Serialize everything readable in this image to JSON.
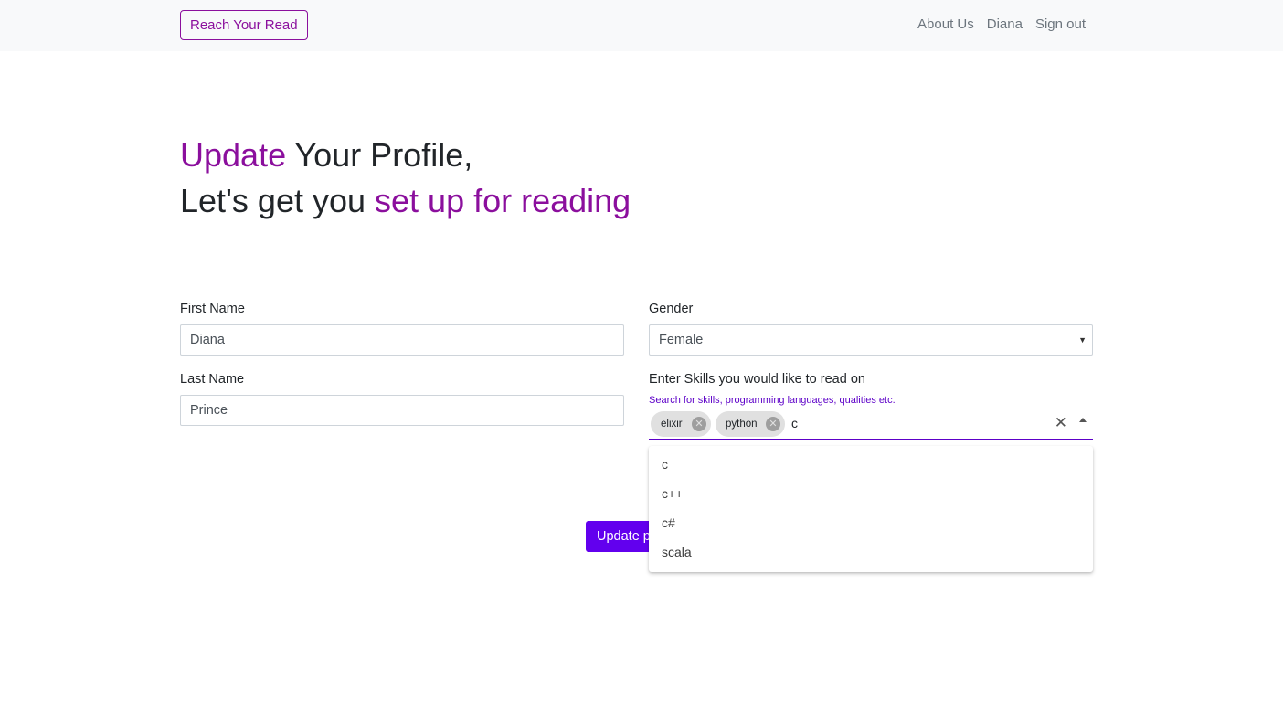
{
  "nav": {
    "brand": "Reach Your Read",
    "links": [
      "About Us",
      "Diana",
      "Sign out"
    ]
  },
  "heading": {
    "line1_accent": "Update",
    "line1_rest": " Your Profile,",
    "line2_plain": "Let's get you ",
    "line2_accent": "set up for reading"
  },
  "form": {
    "first_name_label": "First Name",
    "first_name_value": "Diana",
    "last_name_label": "Last Name",
    "last_name_value": "Prince",
    "gender_label": "Gender",
    "gender_value": "Female",
    "skills_label": "Enter Skills you would like to read on",
    "skills_helper": "Search for skills, programming languages, qualities etc.",
    "skills_chips": [
      "elixir",
      "python"
    ],
    "skills_typed": "c",
    "skills_options": [
      "c",
      "c++",
      "c#",
      "scala"
    ],
    "submit_label": "Update p"
  },
  "colors": {
    "accent": "#8b0f9d",
    "primary": "#6200ee"
  }
}
